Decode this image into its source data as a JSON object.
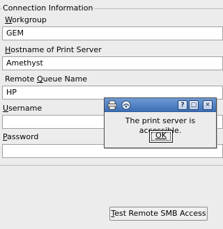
{
  "group": {
    "title": "Connection Information"
  },
  "fields": [
    {
      "label_pre": "",
      "label_key": "W",
      "label_post": "orkgroup",
      "value": "GEM"
    },
    {
      "label_pre": "",
      "label_key": "H",
      "label_post": "ostname of Print Server",
      "value": "Amethyst"
    },
    {
      "label_pre": "Remote ",
      "label_key": "Q",
      "label_post": "ueue Name",
      "value": "HP"
    },
    {
      "label_pre": "",
      "label_key": "U",
      "label_post": "sername",
      "value": ""
    },
    {
      "label_pre": "",
      "label_key": "P",
      "label_post": "assword",
      "value": ""
    }
  ],
  "test_button": {
    "key": "T",
    "rest": "est Remote SMB Access"
  },
  "dialog": {
    "message": "The print server is accessible.",
    "ok_label": "OK",
    "help_glyph": "?",
    "maximize_glyph": "□",
    "close_glyph": "✕"
  }
}
